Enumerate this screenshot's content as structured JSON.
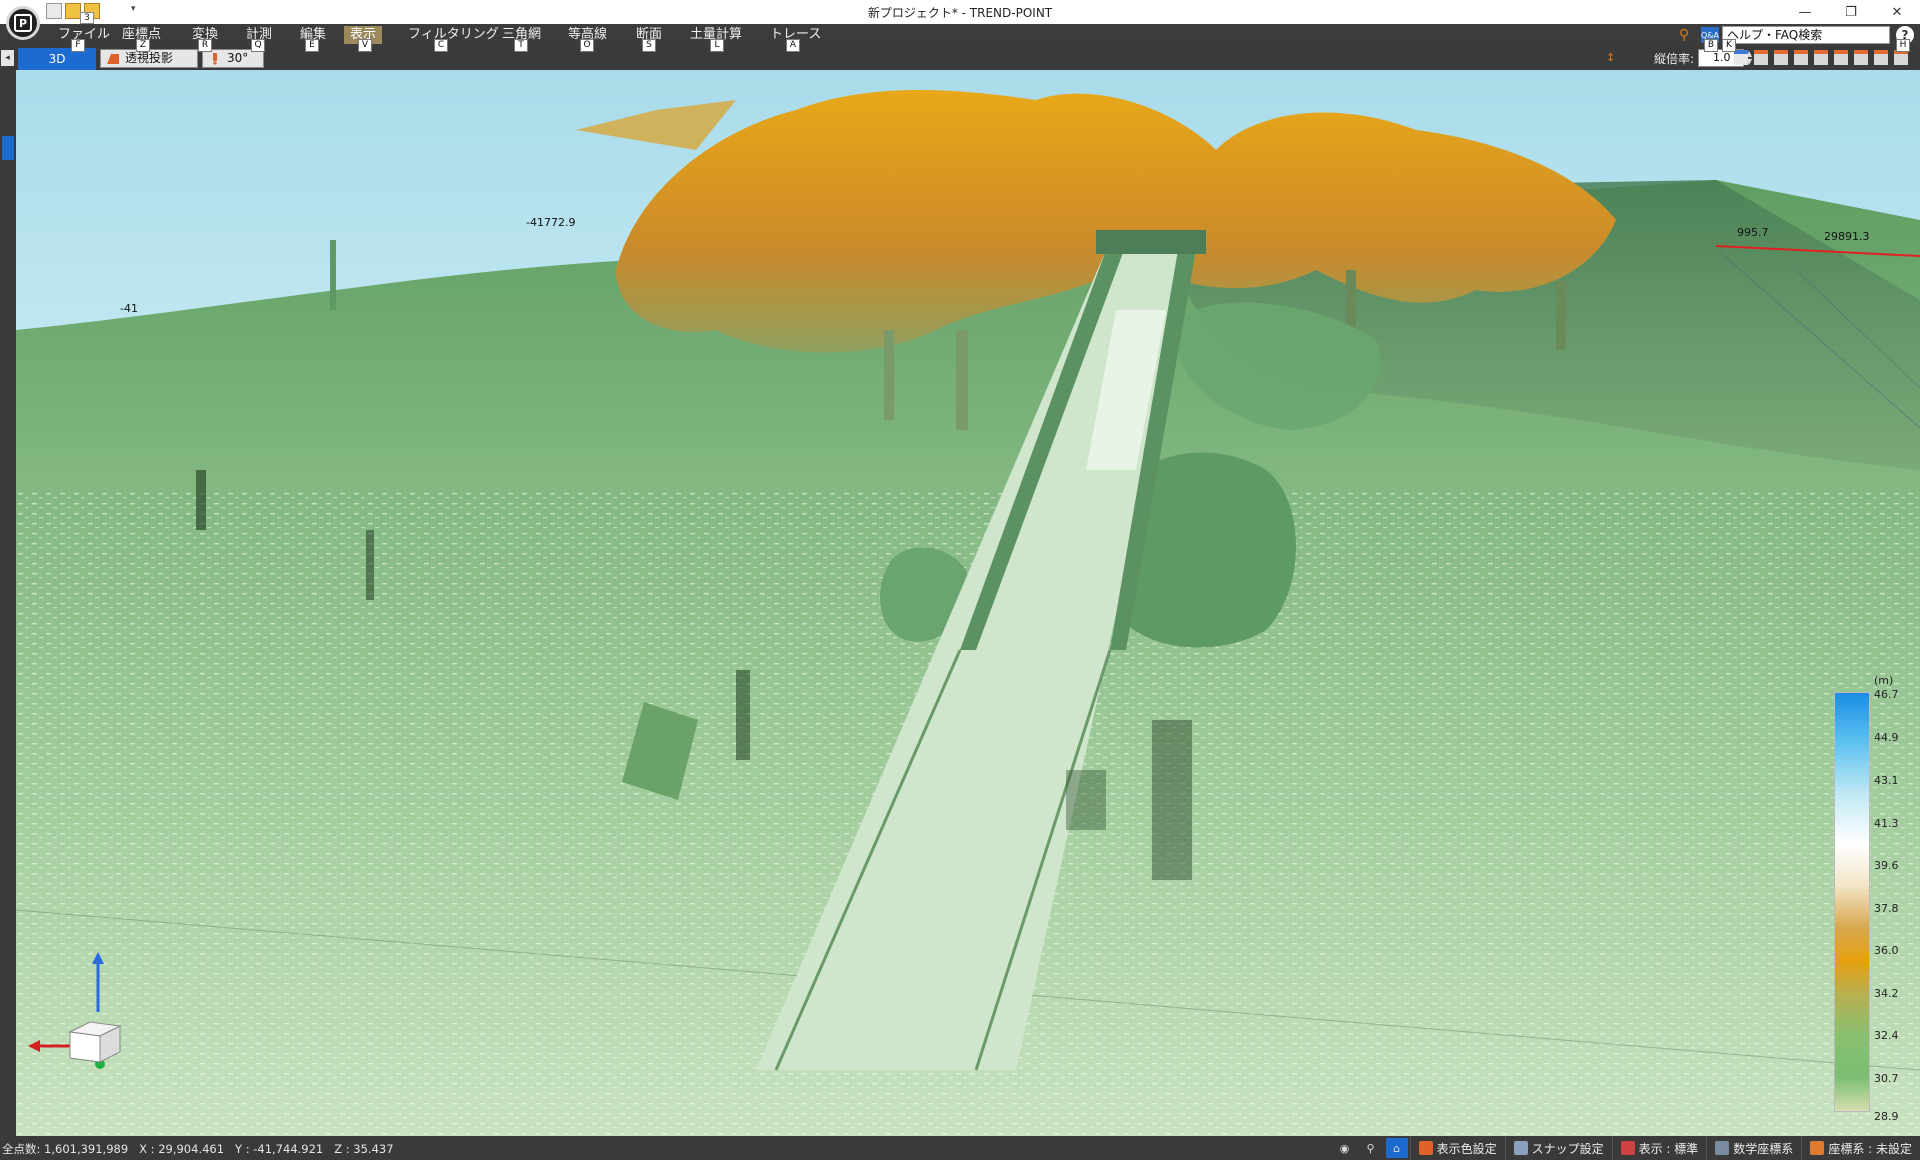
{
  "window": {
    "title": "新プロジェクト* - TREND-POINT",
    "app_button": "P",
    "qat_key": "3",
    "controls": {
      "minimize": "—",
      "restore": "❐",
      "close": "✕"
    }
  },
  "menu": [
    {
      "label": "ファイル",
      "key": "F"
    },
    {
      "label": "座標点",
      "key": "Z"
    },
    {
      "label": "変換",
      "key": "R"
    },
    {
      "label": "計測",
      "key": "Q"
    },
    {
      "label": "編集",
      "key": "E"
    },
    {
      "label": "表示",
      "key": "V"
    },
    {
      "label": "フィルタリング",
      "key": "C"
    },
    {
      "label": "三角網",
      "key": "T"
    },
    {
      "label": "等高線",
      "key": "O"
    },
    {
      "label": "断面",
      "key": "S"
    },
    {
      "label": "土量計算",
      "key": "L"
    },
    {
      "label": "トレース",
      "key": "A"
    }
  ],
  "help": {
    "search_label": "ヘルプ・FAQ検索",
    "help_glyph": "?",
    "keys": [
      "B",
      "K",
      "H"
    ]
  },
  "viewbar": {
    "tab_label": "3D",
    "perspective_label": "透視投影",
    "angle_label": "30°",
    "vertical_scale_label": "縦倍率:",
    "vertical_scale_value": "1.0"
  },
  "scene": {
    "labels": [
      "-41772.9",
      "-41",
      "995.7",
      "29891.3"
    ]
  },
  "legend": {
    "values": [
      "46.7",
      "44.9",
      "43.1",
      "41.3",
      "39.6",
      "37.8",
      "36.0",
      "34.2",
      "32.4",
      "30.7",
      "28.9"
    ],
    "unit": "(m)"
  },
  "status": {
    "points": "全点数: 1,601,391,989",
    "x": "X : 29,904.461",
    "y": "Y : -41,744.921",
    "z": "Z : 35.437",
    "color_settings": "表示色設定",
    "snap_settings": "スナップ設定",
    "display_mode": "表示 : 標準",
    "math_coords": "数学座標系",
    "coord_system": "座標系 : 未設定"
  },
  "colors": {
    "menubar": "#3c3c3c",
    "active_menu": "#9c8a5c",
    "accent": "#1d6ad0",
    "sky": "#b9e3ef",
    "ground": "#8fc08a",
    "tree": "#e0a020"
  }
}
